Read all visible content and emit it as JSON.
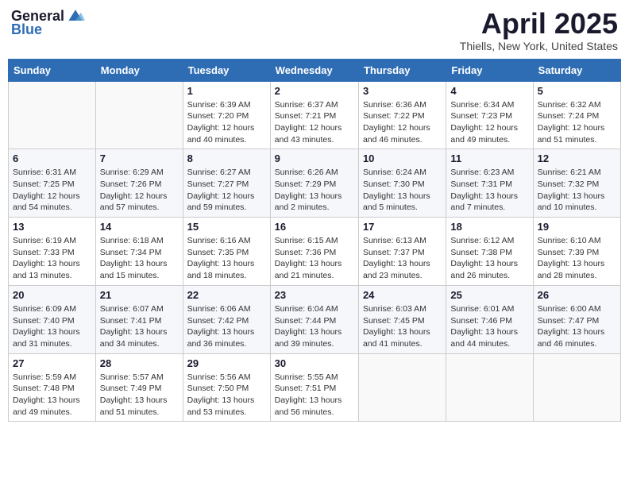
{
  "logo": {
    "general": "General",
    "blue": "Blue"
  },
  "title": "April 2025",
  "subtitle": "Thiells, New York, United States",
  "headers": [
    "Sunday",
    "Monday",
    "Tuesday",
    "Wednesday",
    "Thursday",
    "Friday",
    "Saturday"
  ],
  "weeks": [
    [
      {
        "day": "",
        "sunrise": "",
        "sunset": "",
        "daylight": ""
      },
      {
        "day": "",
        "sunrise": "",
        "sunset": "",
        "daylight": ""
      },
      {
        "day": "1",
        "sunrise": "Sunrise: 6:39 AM",
        "sunset": "Sunset: 7:20 PM",
        "daylight": "Daylight: 12 hours and 40 minutes."
      },
      {
        "day": "2",
        "sunrise": "Sunrise: 6:37 AM",
        "sunset": "Sunset: 7:21 PM",
        "daylight": "Daylight: 12 hours and 43 minutes."
      },
      {
        "day": "3",
        "sunrise": "Sunrise: 6:36 AM",
        "sunset": "Sunset: 7:22 PM",
        "daylight": "Daylight: 12 hours and 46 minutes."
      },
      {
        "day": "4",
        "sunrise": "Sunrise: 6:34 AM",
        "sunset": "Sunset: 7:23 PM",
        "daylight": "Daylight: 12 hours and 49 minutes."
      },
      {
        "day": "5",
        "sunrise": "Sunrise: 6:32 AM",
        "sunset": "Sunset: 7:24 PM",
        "daylight": "Daylight: 12 hours and 51 minutes."
      }
    ],
    [
      {
        "day": "6",
        "sunrise": "Sunrise: 6:31 AM",
        "sunset": "Sunset: 7:25 PM",
        "daylight": "Daylight: 12 hours and 54 minutes."
      },
      {
        "day": "7",
        "sunrise": "Sunrise: 6:29 AM",
        "sunset": "Sunset: 7:26 PM",
        "daylight": "Daylight: 12 hours and 57 minutes."
      },
      {
        "day": "8",
        "sunrise": "Sunrise: 6:27 AM",
        "sunset": "Sunset: 7:27 PM",
        "daylight": "Daylight: 12 hours and 59 minutes."
      },
      {
        "day": "9",
        "sunrise": "Sunrise: 6:26 AM",
        "sunset": "Sunset: 7:29 PM",
        "daylight": "Daylight: 13 hours and 2 minutes."
      },
      {
        "day": "10",
        "sunrise": "Sunrise: 6:24 AM",
        "sunset": "Sunset: 7:30 PM",
        "daylight": "Daylight: 13 hours and 5 minutes."
      },
      {
        "day": "11",
        "sunrise": "Sunrise: 6:23 AM",
        "sunset": "Sunset: 7:31 PM",
        "daylight": "Daylight: 13 hours and 7 minutes."
      },
      {
        "day": "12",
        "sunrise": "Sunrise: 6:21 AM",
        "sunset": "Sunset: 7:32 PM",
        "daylight": "Daylight: 13 hours and 10 minutes."
      }
    ],
    [
      {
        "day": "13",
        "sunrise": "Sunrise: 6:19 AM",
        "sunset": "Sunset: 7:33 PM",
        "daylight": "Daylight: 13 hours and 13 minutes."
      },
      {
        "day": "14",
        "sunrise": "Sunrise: 6:18 AM",
        "sunset": "Sunset: 7:34 PM",
        "daylight": "Daylight: 13 hours and 15 minutes."
      },
      {
        "day": "15",
        "sunrise": "Sunrise: 6:16 AM",
        "sunset": "Sunset: 7:35 PM",
        "daylight": "Daylight: 13 hours and 18 minutes."
      },
      {
        "day": "16",
        "sunrise": "Sunrise: 6:15 AM",
        "sunset": "Sunset: 7:36 PM",
        "daylight": "Daylight: 13 hours and 21 minutes."
      },
      {
        "day": "17",
        "sunrise": "Sunrise: 6:13 AM",
        "sunset": "Sunset: 7:37 PM",
        "daylight": "Daylight: 13 hours and 23 minutes."
      },
      {
        "day": "18",
        "sunrise": "Sunrise: 6:12 AM",
        "sunset": "Sunset: 7:38 PM",
        "daylight": "Daylight: 13 hours and 26 minutes."
      },
      {
        "day": "19",
        "sunrise": "Sunrise: 6:10 AM",
        "sunset": "Sunset: 7:39 PM",
        "daylight": "Daylight: 13 hours and 28 minutes."
      }
    ],
    [
      {
        "day": "20",
        "sunrise": "Sunrise: 6:09 AM",
        "sunset": "Sunset: 7:40 PM",
        "daylight": "Daylight: 13 hours and 31 minutes."
      },
      {
        "day": "21",
        "sunrise": "Sunrise: 6:07 AM",
        "sunset": "Sunset: 7:41 PM",
        "daylight": "Daylight: 13 hours and 34 minutes."
      },
      {
        "day": "22",
        "sunrise": "Sunrise: 6:06 AM",
        "sunset": "Sunset: 7:42 PM",
        "daylight": "Daylight: 13 hours and 36 minutes."
      },
      {
        "day": "23",
        "sunrise": "Sunrise: 6:04 AM",
        "sunset": "Sunset: 7:44 PM",
        "daylight": "Daylight: 13 hours and 39 minutes."
      },
      {
        "day": "24",
        "sunrise": "Sunrise: 6:03 AM",
        "sunset": "Sunset: 7:45 PM",
        "daylight": "Daylight: 13 hours and 41 minutes."
      },
      {
        "day": "25",
        "sunrise": "Sunrise: 6:01 AM",
        "sunset": "Sunset: 7:46 PM",
        "daylight": "Daylight: 13 hours and 44 minutes."
      },
      {
        "day": "26",
        "sunrise": "Sunrise: 6:00 AM",
        "sunset": "Sunset: 7:47 PM",
        "daylight": "Daylight: 13 hours and 46 minutes."
      }
    ],
    [
      {
        "day": "27",
        "sunrise": "Sunrise: 5:59 AM",
        "sunset": "Sunset: 7:48 PM",
        "daylight": "Daylight: 13 hours and 49 minutes."
      },
      {
        "day": "28",
        "sunrise": "Sunrise: 5:57 AM",
        "sunset": "Sunset: 7:49 PM",
        "daylight": "Daylight: 13 hours and 51 minutes."
      },
      {
        "day": "29",
        "sunrise": "Sunrise: 5:56 AM",
        "sunset": "Sunset: 7:50 PM",
        "daylight": "Daylight: 13 hours and 53 minutes."
      },
      {
        "day": "30",
        "sunrise": "Sunrise: 5:55 AM",
        "sunset": "Sunset: 7:51 PM",
        "daylight": "Daylight: 13 hours and 56 minutes."
      },
      {
        "day": "",
        "sunrise": "",
        "sunset": "",
        "daylight": ""
      },
      {
        "day": "",
        "sunrise": "",
        "sunset": "",
        "daylight": ""
      },
      {
        "day": "",
        "sunrise": "",
        "sunset": "",
        "daylight": ""
      }
    ]
  ]
}
